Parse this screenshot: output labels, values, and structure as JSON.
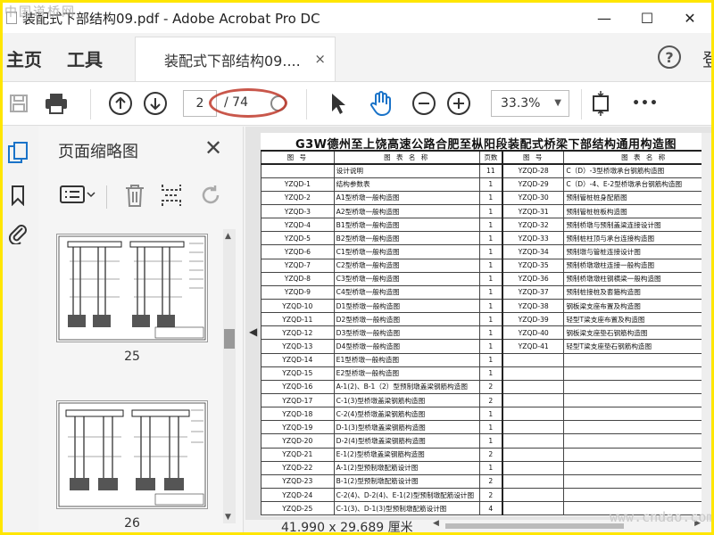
{
  "window": {
    "title": "装配式下部结构09.pdf - Adobe Acrobat Pro DC",
    "watermark_top": "中国道桥网",
    "minimize": "—",
    "maximize": "☐",
    "close": "✕"
  },
  "tabs": {
    "home": "主页",
    "tools": "工具",
    "document": "装配式下部结构09....",
    "document_close": "×",
    "help": "?",
    "login": "登"
  },
  "toolbar": {
    "page_current": "2",
    "page_total": "/ 74",
    "zoom": "33.3%",
    "zoom_dropdown": "▼",
    "more": "•••"
  },
  "colors": {
    "annotation": "#c0392b",
    "accent_blue": "#1a73c8",
    "frame_border": "#ffe600"
  },
  "thumbnails": {
    "title": "页面缩略图",
    "close": "✕",
    "pages": [
      {
        "label": "25"
      },
      {
        "label": "26"
      }
    ]
  },
  "document": {
    "title": "G3W德州至上饶高速公路合肥至枞阳段装配式桥梁下部结构通用构造图",
    "headers": [
      "图 号",
      "图 表 名 称",
      "页数",
      "图 号",
      "图 表 名 称"
    ],
    "rows": [
      [
        "",
        "设计说明",
        "11",
        "YZQD-28",
        "C（D）-3型桥墩承台钢筋构造图"
      ],
      [
        "YZQD-1",
        "结构参数表",
        "1",
        "YZQD-29",
        "C（D）-4、E-2型桥墩承台钢筋构造图"
      ],
      [
        "YZQD-2",
        "A1型桥墩一般构造图",
        "1",
        "YZQD-30",
        "预制管桩桩身配筋图"
      ],
      [
        "YZQD-3",
        "A2型桥墩一般构造图",
        "1",
        "YZQD-31",
        "预制管桩桩板构造图"
      ],
      [
        "YZQD-4",
        "B1型桥墩一般构造图",
        "1",
        "YZQD-32",
        "预制桥墩与预制盖梁连接设计图"
      ],
      [
        "YZQD-5",
        "B2型桥墩一般构造图",
        "1",
        "YZQD-33",
        "预制桩柱顶与承台连接构造图"
      ],
      [
        "YZQD-6",
        "C1型桥墩一般构造图",
        "1",
        "YZQD-34",
        "预制墩与管桩连接设计图"
      ],
      [
        "YZQD-7",
        "C2型桥墩一般构造图",
        "1",
        "YZQD-35",
        "预制桥墩墩柱连接一般构造图"
      ],
      [
        "YZQD-8",
        "C3型桥墩一般构造图",
        "1",
        "YZQD-36",
        "预制桥墩墩柱钢横梁一般构造图"
      ],
      [
        "YZQD-9",
        "C4型桥墩一般构造图",
        "1",
        "YZQD-37",
        "预制桩接桩及套箍构造图"
      ],
      [
        "YZQD-10",
        "D1型桥墩一般构造图",
        "1",
        "YZQD-38",
        "钢板梁支座布置及构造图"
      ],
      [
        "YZQD-11",
        "D2型桥墩一般构造图",
        "1",
        "YZQD-39",
        "轻型T梁支座布置及构造图"
      ],
      [
        "YZQD-12",
        "D3型桥墩一般构造图",
        "1",
        "YZQD-40",
        "钢板梁支座垫石钢筋构造图"
      ],
      [
        "YZQD-13",
        "D4型桥墩一般构造图",
        "1",
        "YZQD-41",
        "轻型T梁支座垫石钢筋构造图"
      ],
      [
        "YZQD-14",
        "E1型桥墩一般构造图",
        "1",
        "",
        ""
      ],
      [
        "YZQD-15",
        "E2型桥墩一般构造图",
        "1",
        "",
        ""
      ],
      [
        "YZQD-16",
        "A-1(2)、B-1（2）型预制墩盖梁钢筋构造图",
        "2",
        "",
        ""
      ],
      [
        "YZQD-17",
        "C-1(3)型桥墩盖梁钢筋构造图",
        "2",
        "",
        ""
      ],
      [
        "YZQD-18",
        "C-2(4)型桥墩盖梁钢筋构造图",
        "1",
        "",
        ""
      ],
      [
        "YZQD-19",
        "D-1(3)型桥墩盖梁钢筋构造图",
        "1",
        "",
        ""
      ],
      [
        "YZQD-20",
        "D-2(4)型桥墩盖梁钢筋构造图",
        "1",
        "",
        ""
      ],
      [
        "YZQD-21",
        "E-1(2)型桥墩盖梁钢筋构造图",
        "2",
        "",
        ""
      ],
      [
        "YZQD-22",
        "A-1(2)型预制墩配筋设计图",
        "1",
        "",
        ""
      ],
      [
        "YZQD-23",
        "B-1(2)型预制墩配筋设计图",
        "2",
        "",
        ""
      ],
      [
        "YZQD-24",
        "C-2(4)、D-2(4)、E-1(2)型预制墩配筋设计图",
        "2",
        "",
        ""
      ],
      [
        "YZQD-25",
        "C-1(3)、D-1(3)型预制墩配筋设计图",
        "4",
        "",
        ""
      ]
    ]
  },
  "status": {
    "page_size": "41.990 x 29.689 厘米"
  },
  "watermark_bottom": "www.cndao.com"
}
